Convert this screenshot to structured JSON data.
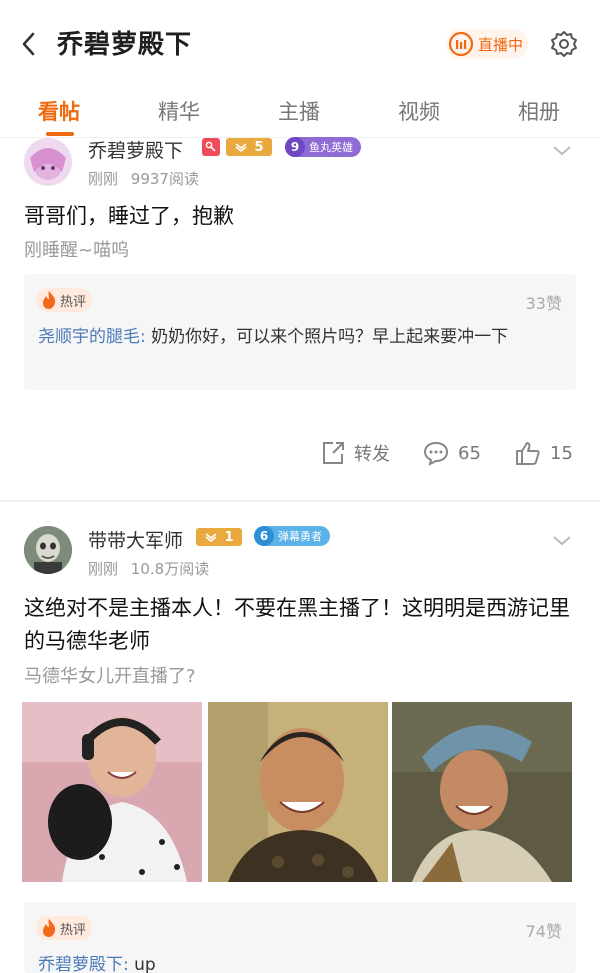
{
  "header": {
    "title": "乔碧萝殿下",
    "live_label": "直播中",
    "accent": "#f06a12"
  },
  "tabs": [
    {
      "label": "看帖",
      "active": true
    },
    {
      "label": "精华"
    },
    {
      "label": "主播"
    },
    {
      "label": "视频"
    },
    {
      "label": "相册"
    }
  ],
  "posts": [
    {
      "username": "乔碧萝殿下",
      "level_badge": "5",
      "fan_level": "9",
      "fan_title": "鱼丸英雄",
      "time": "刚刚",
      "reads": "9937阅读",
      "text": "哥哥们，睡过了，抱歉",
      "subtext": "刚睡醒~喵呜",
      "hot_label": "热评",
      "hot_likes": "33赞",
      "hot_author": "尧顺宇的腿毛:",
      "hot_text": "奶奶你好，可以来个照片吗？早上起来要冲一下",
      "share_label": "转发",
      "comment_count": "65",
      "like_count": "15"
    },
    {
      "username": "带带大军师",
      "level_badge": "1",
      "fan_level": "6",
      "fan_title": "弹幕勇者",
      "time": "刚刚",
      "reads": "10.8万阅读",
      "text": "这绝对不是主播本人！不要在黑主播了！这明明是西游记里的马德华老师",
      "subtext": "马德华女儿开直播了?",
      "hot_label": "热评",
      "hot_likes": "74赞",
      "hot_author": "乔碧萝殿下:",
      "hot_text": "up"
    }
  ]
}
